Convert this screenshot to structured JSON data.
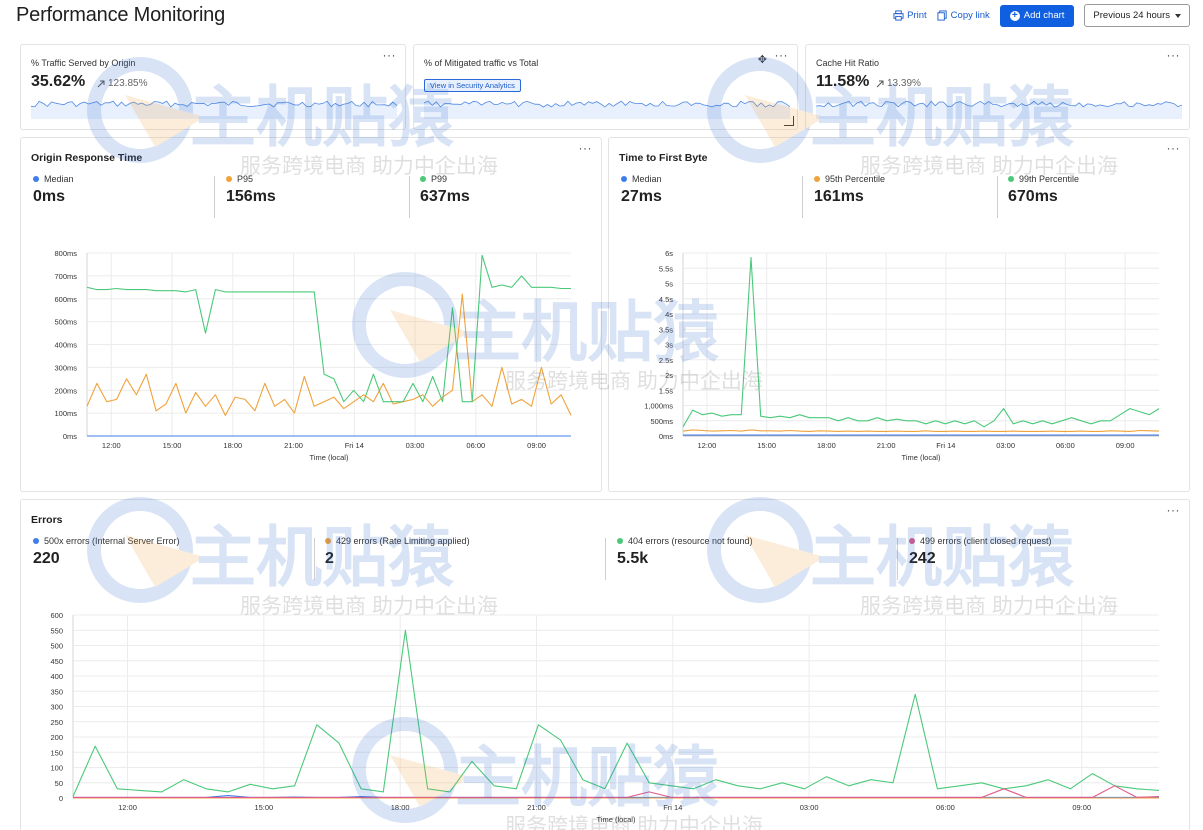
{
  "page": {
    "title": "Performance Monitoring"
  },
  "toolbar": {
    "print_label": "Print",
    "copy_link_label": "Copy link",
    "add_chart_label": "Add chart",
    "time_range_value": "Previous 24 hours"
  },
  "traffic_card": {
    "title": "% Traffic Served by Origin",
    "value": "35.62%",
    "delta": "123.85%"
  },
  "mitigated_card": {
    "title": "% of Mitigated traffic vs Total",
    "link_label": "View in Security Analytics"
  },
  "cache_card": {
    "title": "Cache Hit Ratio",
    "value": "11.58%",
    "delta": "13.39%"
  },
  "menu_glyph": "···",
  "origin_response": {
    "title": "Origin Response Time",
    "metrics": [
      {
        "label": "Median",
        "value": "0ms",
        "color": "#3f7ee8"
      },
      {
        "label": "P95",
        "value": "156ms",
        "color": "#f0a23b"
      },
      {
        "label": "P99",
        "value": "637ms",
        "color": "#4bc97a"
      }
    ]
  },
  "ttfb": {
    "title": "Time to First Byte",
    "metrics": [
      {
        "label": "Median",
        "value": "27ms",
        "color": "#3f7ee8"
      },
      {
        "label": "95th Percentile",
        "value": "161ms",
        "color": "#f0a23b"
      },
      {
        "label": "99th Percentile",
        "value": "670ms",
        "color": "#4bc97a"
      }
    ]
  },
  "errors": {
    "title": "Errors",
    "metrics": [
      {
        "label": "500x errors (Internal Server Error)",
        "value": "220",
        "color": "#3f7ee8"
      },
      {
        "label": "429 errors (Rate Limiting applied)",
        "value": "2",
        "color": "#f0a23b"
      },
      {
        "label": "404 errors (resource not found)",
        "value": "5.5k",
        "color": "#4bc97a"
      },
      {
        "label": "499 errors (client closed request)",
        "value": "242",
        "color": "#e05a8a"
      }
    ]
  },
  "watermark": {
    "brand": "主机贴猿",
    "slogan": "服务跨境电商 助力中企出海"
  },
  "chart_data": [
    {
      "id": "origin_response_time",
      "type": "line",
      "title": "",
      "xlabel": "Time (local)",
      "ylabel": "",
      "x_tick_labels": [
        "12:00",
        "15:00",
        "18:00",
        "21:00",
        "Fri 14",
        "03:00",
        "06:00",
        "09:00"
      ],
      "x_ticks_at_hours": [
        1,
        4,
        7,
        10,
        13,
        16,
        19,
        22
      ],
      "x_range_hours": [
        -0.2,
        23.7
      ],
      "y_tick_labels": [
        "0ms",
        "100ms",
        "200ms",
        "300ms",
        "400ms",
        "500ms",
        "600ms",
        "700ms",
        "800ms"
      ],
      "ylim": [
        0,
        800
      ],
      "grid": true,
      "series": [
        {
          "name": "Median",
          "color": "#3f7ee8",
          "values": [
            0,
            0,
            0,
            0,
            0,
            0,
            0,
            0,
            0,
            0,
            0,
            0,
            0,
            0,
            0,
            0,
            0,
            0,
            0,
            0,
            0,
            0,
            0,
            0,
            0,
            0,
            0,
            0,
            0,
            0,
            0,
            0,
            0,
            0,
            0,
            0,
            0,
            0,
            0,
            0,
            0,
            0,
            0,
            0,
            0,
            0,
            0,
            0,
            0,
            0
          ]
        },
        {
          "name": "P95",
          "color": "#f0a23b",
          "values": [
            130,
            230,
            150,
            160,
            250,
            180,
            270,
            110,
            140,
            230,
            100,
            190,
            130,
            180,
            90,
            170,
            160,
            110,
            230,
            130,
            160,
            100,
            260,
            130,
            150,
            170,
            120,
            150,
            180,
            150,
            230,
            140,
            150,
            160,
            180,
            130,
            170,
            200,
            620,
            150,
            180,
            130,
            300,
            140,
            160,
            130,
            300,
            140,
            180,
            90
          ]
        },
        {
          "name": "P99",
          "color": "#4bc97a",
          "values": [
            650,
            640,
            640,
            645,
            640,
            640,
            640,
            635,
            635,
            635,
            630,
            640,
            450,
            640,
            630,
            630,
            630,
            630,
            630,
            630,
            630,
            630,
            630,
            630,
            270,
            250,
            150,
            200,
            150,
            270,
            150,
            150,
            150,
            230,
            150,
            260,
            150,
            560,
            150,
            150,
            790,
            650,
            660,
            650,
            700,
            650,
            650,
            650,
            645,
            645
          ]
        }
      ]
    },
    {
      "id": "time_to_first_byte",
      "type": "line",
      "title": "",
      "xlabel": "Time (local)",
      "ylabel": "",
      "x_tick_labels": [
        "12:00",
        "15:00",
        "18:00",
        "21:00",
        "Fri 14",
        "03:00",
        "06:00",
        "09:00"
      ],
      "x_ticks_at_hours": [
        1,
        4,
        7,
        10,
        13,
        16,
        19,
        22
      ],
      "x_range_hours": [
        -0.2,
        23.7
      ],
      "y_tick_labels": [
        "0ms",
        "500ms",
        "1,000ms",
        "1.5s",
        "2s",
        "2.5s",
        "3s",
        "3.5s",
        "4s",
        "4.5s",
        "5s",
        "5.5s",
        "6s"
      ],
      "ylim": [
        0,
        6000
      ],
      "grid": true,
      "series": [
        {
          "name": "Median",
          "color": "#3f7ee8",
          "values": [
            30,
            30,
            30,
            30,
            30,
            30,
            30,
            30,
            30,
            30,
            30,
            30,
            30,
            30,
            30,
            30,
            30,
            30,
            30,
            30,
            30,
            30,
            30,
            30,
            30,
            30,
            30,
            30,
            30,
            30,
            30,
            30,
            30,
            30,
            30,
            30,
            30,
            30,
            30,
            30,
            30,
            30,
            30,
            30,
            30,
            30,
            30,
            30,
            30,
            30
          ]
        },
        {
          "name": "95th Percentile",
          "color": "#f0a23b",
          "values": [
            160,
            200,
            180,
            160,
            170,
            180,
            160,
            200,
            170,
            170,
            160,
            180,
            160,
            150,
            170,
            160,
            150,
            160,
            150,
            160,
            150,
            150,
            160,
            150,
            150,
            170,
            150,
            150,
            160,
            150,
            150,
            160,
            150,
            150,
            160,
            150,
            150,
            150,
            160,
            150,
            150,
            160,
            150,
            150,
            170,
            160,
            150,
            180,
            170,
            160
          ]
        },
        {
          "name": "99th Percentile",
          "color": "#4bc97a",
          "values": [
            300,
            850,
            700,
            750,
            650,
            700,
            700,
            5850,
            650,
            600,
            650,
            600,
            700,
            600,
            600,
            600,
            500,
            600,
            500,
            500,
            600,
            500,
            550,
            500,
            500,
            400,
            500,
            400,
            500,
            400,
            500,
            300,
            500,
            900,
            400,
            500,
            400,
            500,
            400,
            500,
            600,
            500,
            400,
            500,
            500,
            700,
            900,
            800,
            700,
            900
          ]
        }
      ]
    },
    {
      "id": "errors",
      "type": "line",
      "title": "",
      "xlabel": "Time (local)",
      "ylabel": "",
      "x_tick_labels": [
        "12:00",
        "15:00",
        "18:00",
        "21:00",
        "Fri 14",
        "03:00",
        "06:00",
        "09:00"
      ],
      "x_ticks_at_hours": [
        1,
        4,
        7,
        10,
        13,
        16,
        19,
        22
      ],
      "x_range_hours": [
        -0.2,
        23.7
      ],
      "y_tick_labels": [
        "0",
        "50",
        "100",
        "150",
        "200",
        "250",
        "300",
        "350",
        "400",
        "450",
        "500",
        "550",
        "600"
      ],
      "ylim": [
        0,
        600
      ],
      "grid": true,
      "series": [
        {
          "name": "500x errors (Internal Server Error)",
          "color": "#3f7ee8",
          "values": [
            2,
            2,
            2,
            2,
            2,
            2,
            2,
            8,
            2,
            2,
            3,
            2,
            2,
            5,
            2,
            2,
            2,
            2,
            2,
            2,
            2,
            2,
            2,
            2,
            2,
            2,
            2,
            2,
            2,
            2,
            2,
            2,
            2,
            2,
            2,
            2,
            2,
            2,
            2,
            2,
            2,
            2,
            2,
            2,
            2,
            2,
            2,
            2,
            2,
            2
          ]
        },
        {
          "name": "429 errors (Rate Limiting applied)",
          "color": "#f0a23b",
          "values": [
            0,
            0,
            0,
            0,
            0,
            0,
            0,
            0,
            0,
            0,
            0,
            0,
            0,
            0,
            0,
            0,
            0,
            0,
            0,
            0,
            0,
            0,
            0,
            0,
            0,
            0,
            0,
            0,
            0,
            0,
            0,
            0,
            0,
            0,
            0,
            0,
            0,
            0,
            0,
            0,
            0,
            0,
            0,
            0,
            0,
            0,
            0,
            0,
            0,
            0
          ]
        },
        {
          "name": "404 errors (resource not found)",
          "color": "#4bc97a",
          "values": [
            5,
            170,
            30,
            25,
            20,
            60,
            30,
            20,
            45,
            30,
            40,
            240,
            180,
            30,
            20,
            550,
            30,
            20,
            120,
            40,
            30,
            240,
            190,
            60,
            30,
            180,
            50,
            40,
            30,
            60,
            40,
            30,
            50,
            30,
            70,
            40,
            60,
            50,
            340,
            30,
            40,
            50,
            30,
            40,
            60,
            30,
            80,
            40,
            30,
            25
          ]
        },
        {
          "name": "499 errors (client closed request)",
          "color": "#e05a8a",
          "values": [
            2,
            2,
            2,
            2,
            2,
            2,
            2,
            2,
            2,
            2,
            2,
            2,
            2,
            2,
            2,
            2,
            2,
            2,
            2,
            2,
            2,
            2,
            2,
            2,
            2,
            2,
            20,
            2,
            2,
            2,
            2,
            2,
            2,
            2,
            2,
            2,
            2,
            2,
            2,
            2,
            2,
            2,
            30,
            2,
            2,
            2,
            2,
            40,
            2,
            5
          ]
        }
      ]
    }
  ]
}
